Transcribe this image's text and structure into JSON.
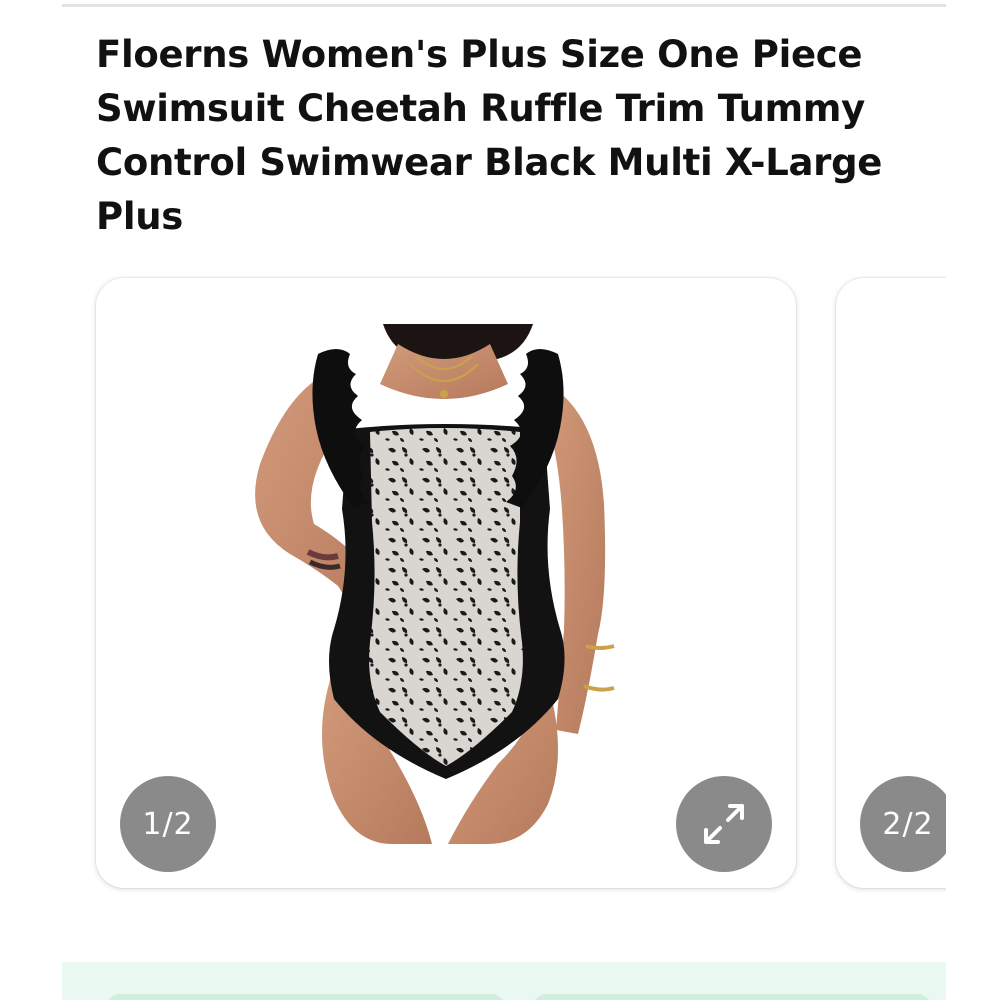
{
  "product": {
    "title": "Floerns Women's Plus Size One Piece Swimsuit Cheetah Ruffle Trim Tummy Control Swimwear Black Multi X-Large Plus"
  },
  "gallery": {
    "slides": [
      {
        "counter": "1/2",
        "image_icon": "product-photo-icon"
      },
      {
        "counter": "2/2"
      }
    ],
    "expand_icon": "expand-icon"
  },
  "colors": {
    "counter_bg": "#8a8a8a",
    "panel_bg": "#e9f8f1",
    "title_text": "#111111"
  }
}
